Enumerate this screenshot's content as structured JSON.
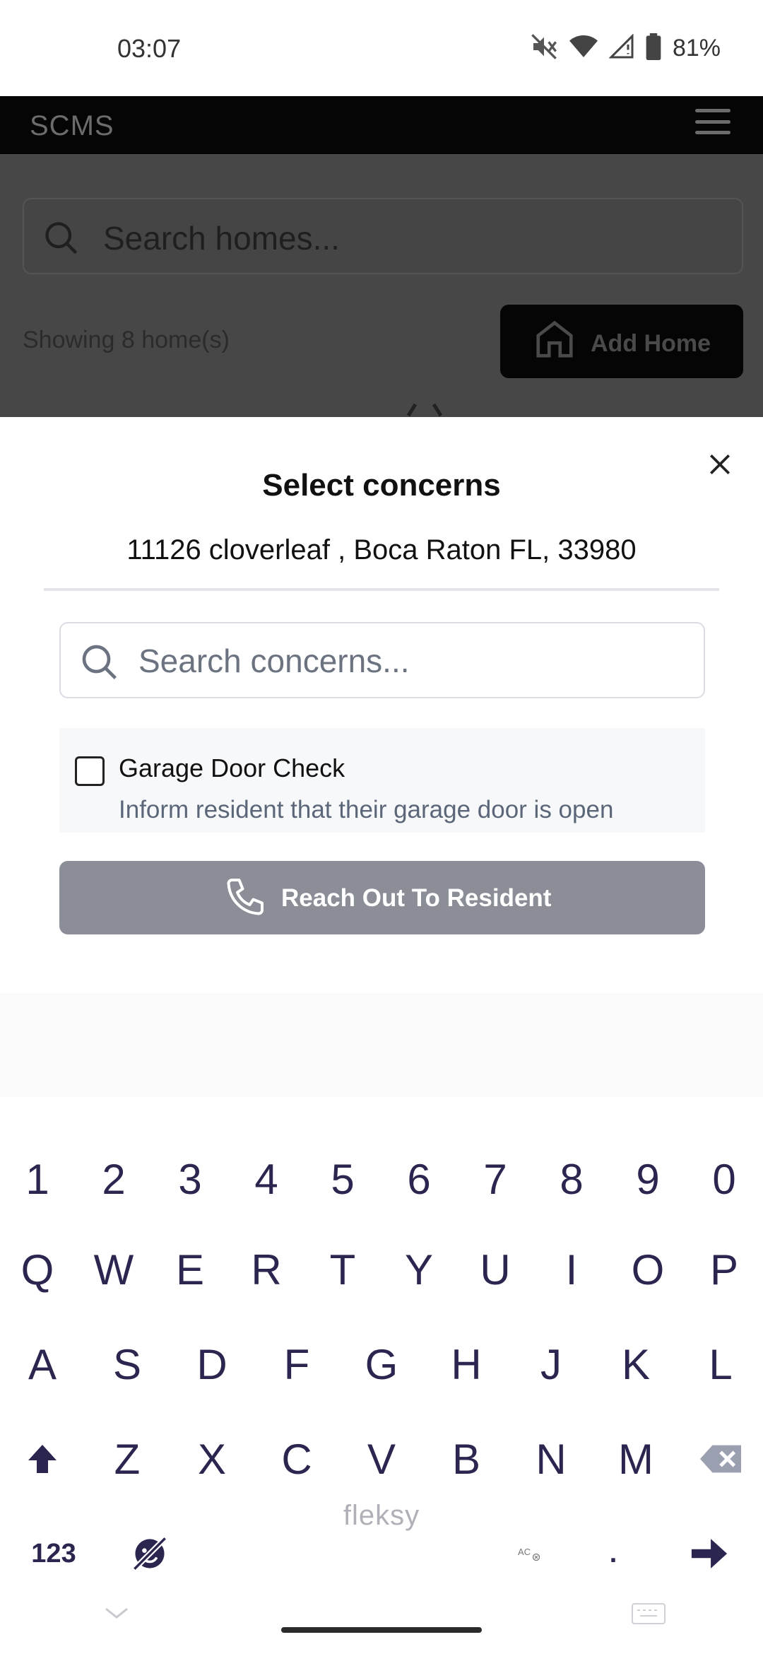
{
  "status_bar": {
    "time": "03:07",
    "battery": "81%",
    "icons": [
      "mute-icon",
      "wifi-icon",
      "signal-icon",
      "battery-icon"
    ]
  },
  "app_bar": {
    "brand": "SCMS",
    "menu_icon": "hamburger-icon"
  },
  "background_page": {
    "search_placeholder": "Search homes...",
    "count_text": "Showing 8 home(s)",
    "add_button_label": "Add Home"
  },
  "modal": {
    "title": "Select concerns",
    "address": "11126 cloverleaf , Boca Raton FL, 33980",
    "search_placeholder": "Search concerns...",
    "concerns": [
      {
        "name": "Garage Door Check",
        "description": "Inform resident that their garage door is open",
        "checked": false
      }
    ],
    "action_button_label": "Reach Out To Resident"
  },
  "keyboard": {
    "number_row": [
      "1",
      "2",
      "3",
      "4",
      "5",
      "6",
      "7",
      "8",
      "9",
      "0"
    ],
    "row1": [
      "Q",
      "W",
      "E",
      "R",
      "T",
      "Y",
      "U",
      "I",
      "O",
      "P"
    ],
    "row2": [
      "A",
      "S",
      "D",
      "F",
      "G",
      "H",
      "J",
      "K",
      "L"
    ],
    "row3": [
      "Z",
      "X",
      "C",
      "V",
      "B",
      "N",
      "M"
    ],
    "mode_key": "123",
    "brand": "fleksy",
    "period_key": ".",
    "colors": {
      "key_text": "#2b2650",
      "brand_text": "#b0b0b8"
    }
  },
  "colors": {
    "app_bar": "#050505",
    "button_disabled": "#8b8e96",
    "description_text": "#5b6678"
  }
}
